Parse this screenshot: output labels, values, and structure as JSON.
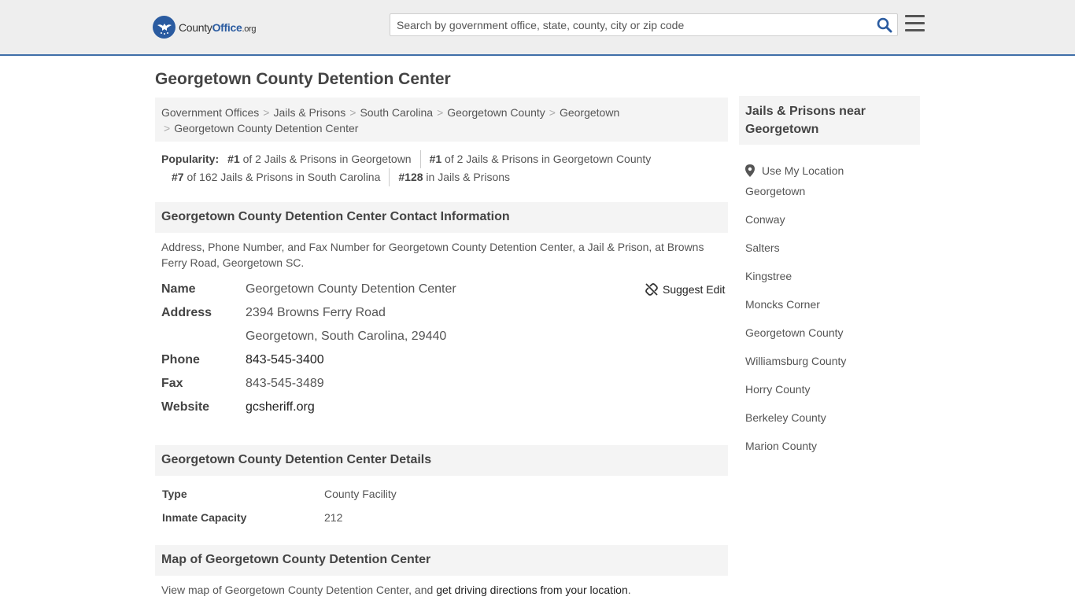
{
  "header": {
    "logo_pre": "County",
    "logo_brand": "Office",
    "logo_tld": ".org",
    "search_placeholder": "Search by government office, state, county, city or zip code"
  },
  "page_title": "Georgetown County Detention Center",
  "breadcrumbs": [
    "Government Offices",
    "Jails & Prisons",
    "South Carolina",
    "Georgetown County",
    "Georgetown",
    "Georgetown County Detention Center"
  ],
  "popularity": {
    "label": "Popularity:",
    "items": [
      {
        "rank": "#1",
        "text": " of 2 Jails & Prisons in Georgetown"
      },
      {
        "rank": "#1",
        "text": " of 2 Jails & Prisons in Georgetown County"
      },
      {
        "rank": "#7",
        "text": " of 162 Jails & Prisons in South Carolina"
      },
      {
        "rank": "#128",
        "text": " in Jails & Prisons"
      }
    ]
  },
  "contact": {
    "heading": "Georgetown County Detention Center Contact Information",
    "description": "Address, Phone Number, and Fax Number for Georgetown County Detention Center, a Jail & Prison, at Browns Ferry Road, Georgetown SC.",
    "suggest_edit": "Suggest Edit",
    "name_label": "Name",
    "name_value": "Georgetown County Detention Center",
    "address_label": "Address",
    "address_line1": "2394 Browns Ferry Road",
    "address_line2": "Georgetown, South Carolina, 29440",
    "phone_label": "Phone",
    "phone_value": "843-545-3400",
    "fax_label": "Fax",
    "fax_value": "843-545-3489",
    "website_label": "Website",
    "website_value": "gcsheriff.org"
  },
  "details": {
    "heading": "Georgetown County Detention Center Details",
    "type_label": "Type",
    "type_value": "County Facility",
    "capacity_label": "Inmate Capacity",
    "capacity_value": "212"
  },
  "map": {
    "heading": "Map of Georgetown County Detention Center",
    "description_pre": "View map of Georgetown County Detention Center, and ",
    "directions_link": "get driving directions from your location",
    "description_post": "."
  },
  "sidebar": {
    "heading": "Jails & Prisons near Georgetown",
    "use_location": "Use My Location",
    "links": [
      "Georgetown",
      "Conway",
      "Salters",
      "Kingstree",
      "Moncks Corner",
      "Georgetown County",
      "Williamsburg County",
      "Horry County",
      "Berkeley County",
      "Marion County"
    ]
  },
  "colors": {
    "header_bg": "#eeeeee",
    "header_border": "#3f6ea8",
    "brand_blue": "#2a5ba0",
    "panel_bg": "#f4f4f4"
  }
}
